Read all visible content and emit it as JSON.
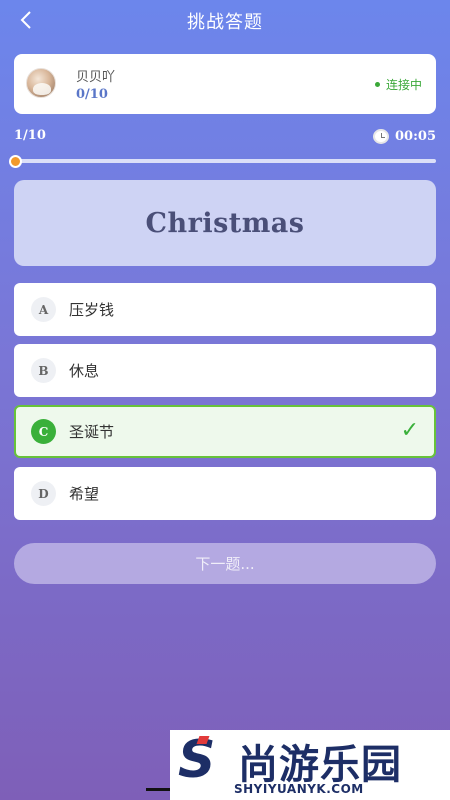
{
  "header": {
    "title": "挑战答题",
    "back_icon": "chevron-left-icon"
  },
  "player": {
    "name": "贝贝吖",
    "score": "0/10",
    "status": "连接中",
    "status_color": "#3aa838"
  },
  "progress": {
    "label": "1/10",
    "fraction": 0.0,
    "color": "#f39a2c"
  },
  "timer": {
    "value": "00:05",
    "icon": "stopwatch-icon"
  },
  "question": {
    "word": "Christmas"
  },
  "options": [
    {
      "letter": "A",
      "text": "压岁钱"
    },
    {
      "letter": "B",
      "text": "休息"
    },
    {
      "letter": "C",
      "text": "圣诞节",
      "correct": true
    },
    {
      "letter": "D",
      "text": "希望"
    }
  ],
  "correct_mark": "✓",
  "correct_color": "#3ab03a",
  "next_button": {
    "label": "下一题..."
  },
  "watermark": {
    "brand": "尚游乐园",
    "url": "SHYIYUANYK.COM"
  }
}
